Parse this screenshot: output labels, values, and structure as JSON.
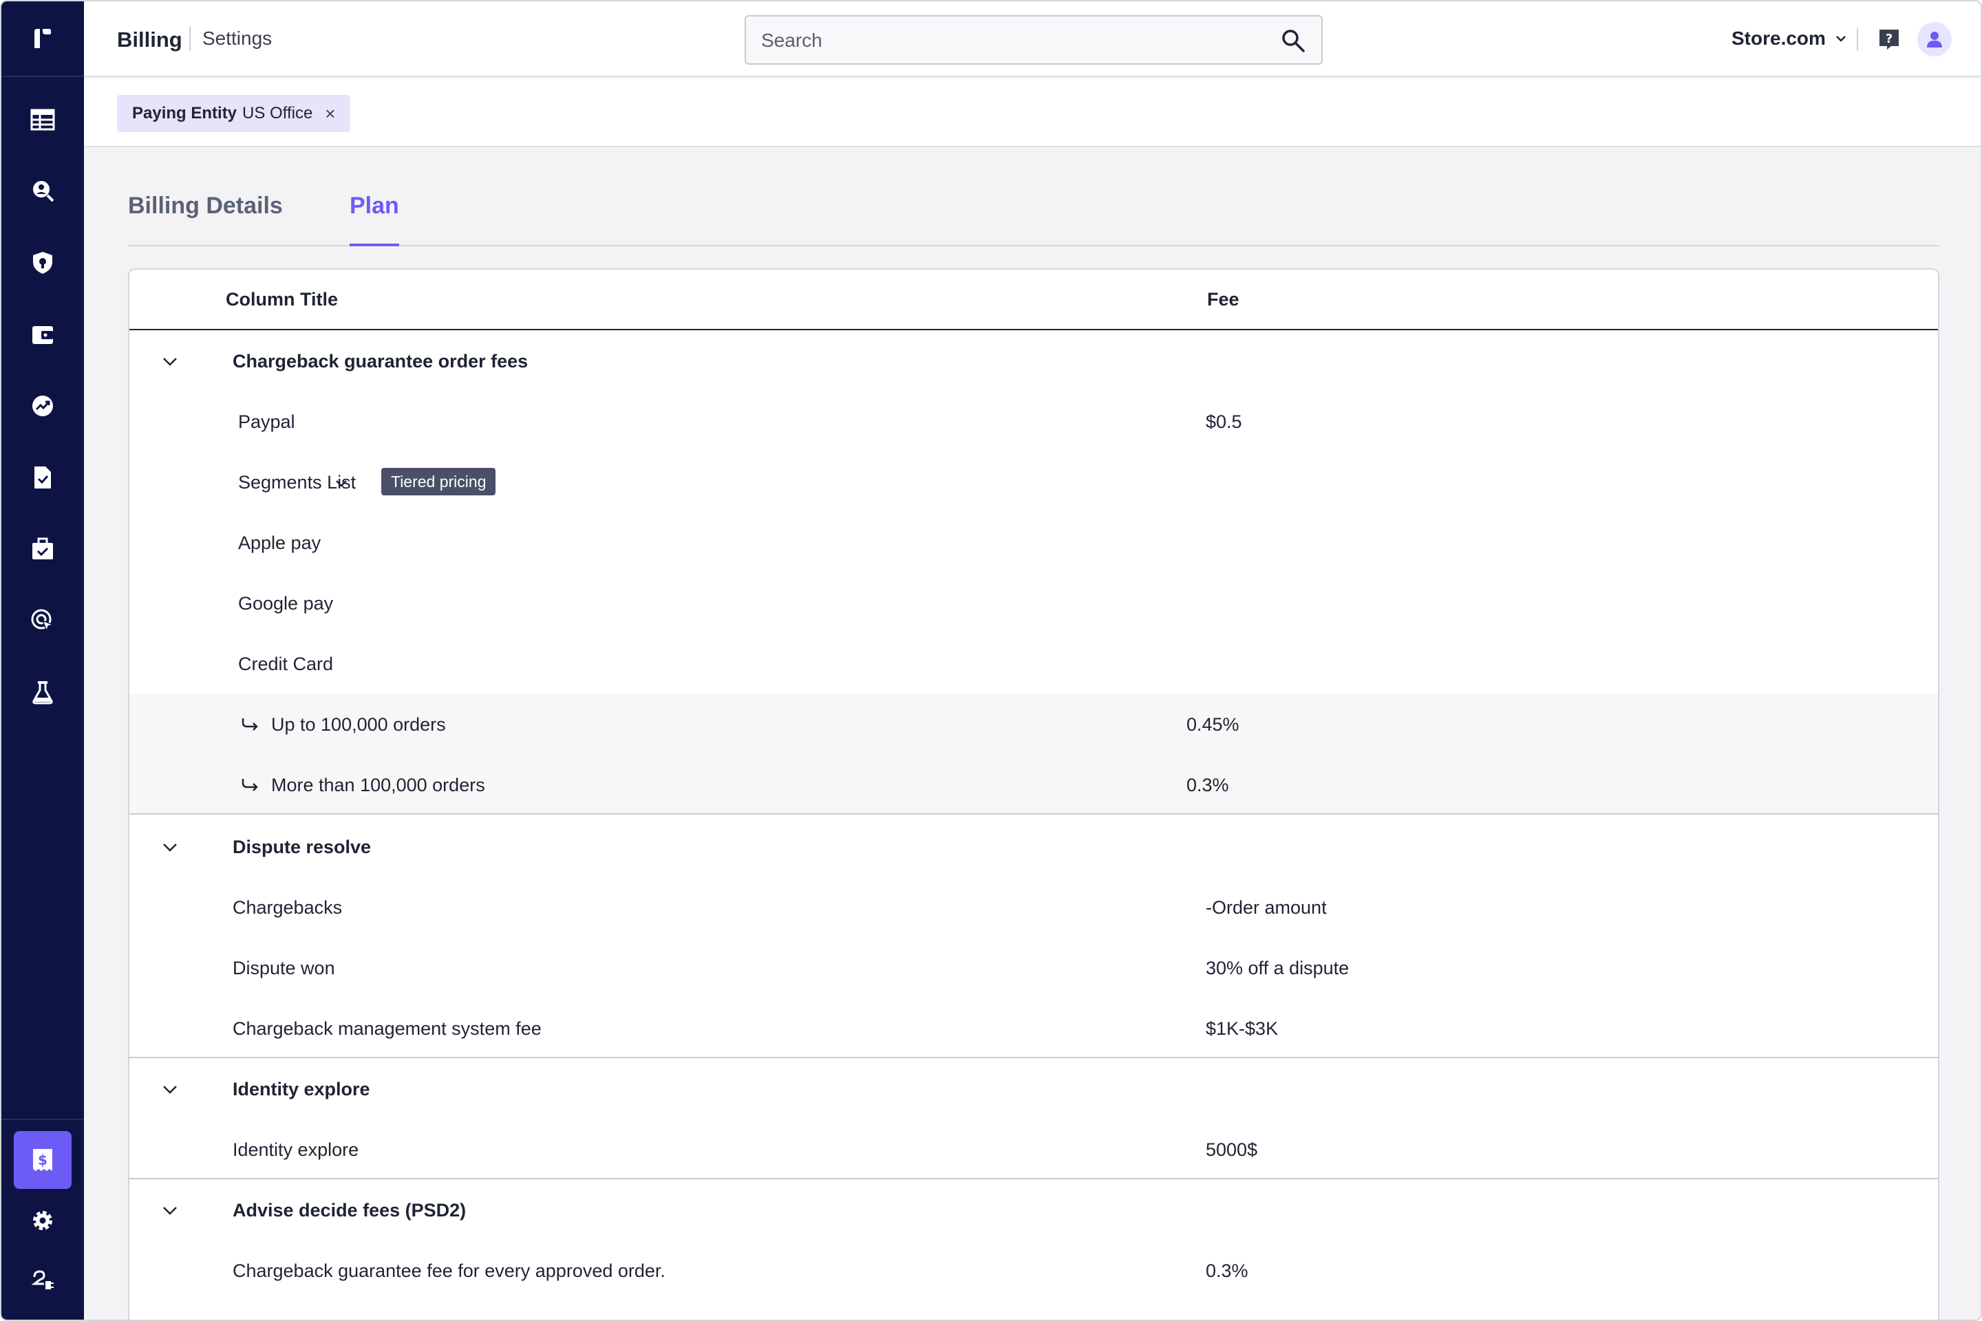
{
  "topbar": {
    "breadcrumb_main": "Billing",
    "breadcrumb_sub": "Settings",
    "search_placeholder": "Search",
    "store": "Store.com"
  },
  "filter_chip": {
    "key": "Paying Entity",
    "value": "US Office",
    "close": "×"
  },
  "tabs": [
    {
      "label": "Billing Details",
      "active": false
    },
    {
      "label": "Plan",
      "active": true
    }
  ],
  "table": {
    "columns": {
      "title": "Column Title",
      "fee": "Fee"
    },
    "groups": [
      {
        "title": "Chargeback guarantee order fees",
        "rows": [
          {
            "name": "Paypal",
            "fee": "$0.5"
          },
          {
            "name": "Segments List",
            "badge": "Tiered pricing"
          },
          {
            "name": "Apple pay",
            "fee": ""
          },
          {
            "name": "Google pay",
            "fee": ""
          },
          {
            "name": "Credit Card",
            "fee": ""
          },
          {
            "name": "Up to 100,000 orders",
            "fee": "0.45%"
          },
          {
            "name": "More than 100,000 orders",
            "fee": "0.3%"
          }
        ]
      },
      {
        "title": "Dispute resolve",
        "rows": [
          {
            "name": "Chargebacks",
            "fee": "-Order amount"
          },
          {
            "name": "Dispute won",
            "fee": "30% off a dispute"
          },
          {
            "name": "Chargeback management system fee",
            "fee": "$1K-$3K"
          }
        ]
      },
      {
        "title": "Identity explore",
        "rows": [
          {
            "name": "Identity explore",
            "fee": "5000$"
          }
        ]
      },
      {
        "title": "Advise decide fees (PSD2)",
        "rows": [
          {
            "name": "Chargeback guarantee fee for every approved order.",
            "fee": "0.3%"
          }
        ]
      }
    ]
  },
  "sidebar_icons": [
    "logo-icon",
    "dashboard-icon",
    "investigate-icon",
    "shield-icon",
    "wallet-icon",
    "analytics-icon",
    "document-check-icon",
    "briefcase-check-icon",
    "target-cursor-icon",
    "lab-flask-icon",
    "billing-icon",
    "gear-icon",
    "integrations-icon"
  ],
  "colors": {
    "sidebar": "#0d1444",
    "accent": "#6c5cf5",
    "chip": "#e6e3fb",
    "badge": "#4a5068"
  }
}
